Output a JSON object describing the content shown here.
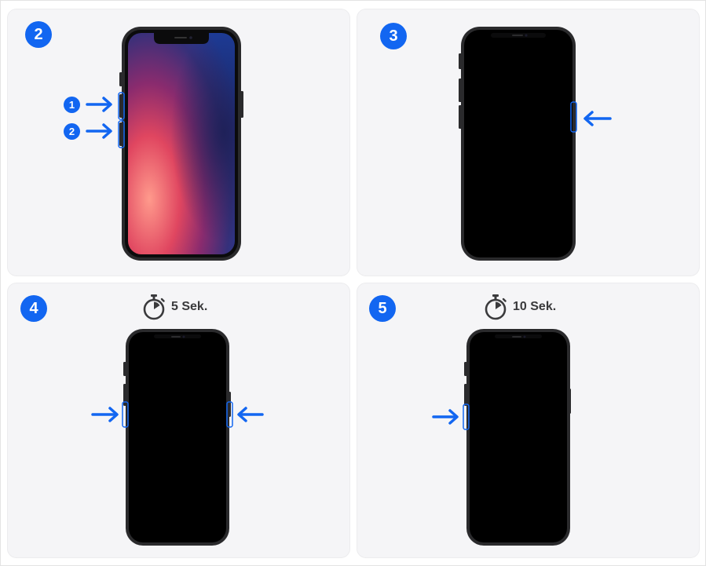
{
  "panels": [
    {
      "step": "2",
      "timer_label": "",
      "small_badges": [
        "1",
        "2"
      ]
    },
    {
      "step": "3",
      "timer_label": ""
    },
    {
      "step": "4",
      "timer_label": "5 Sek."
    },
    {
      "step": "5",
      "timer_label": "10 Sek."
    }
  ],
  "colors": {
    "accent_blue": "#1266f1",
    "panel_bg": "#f5f5f7",
    "phone_frame": "#2a2a2c",
    "phone_screen": "#000000",
    "timer_text": "#3a3a3c"
  },
  "icons": [
    "stopwatch-icon",
    "arrow-right-icon",
    "arrow-left-icon"
  ]
}
